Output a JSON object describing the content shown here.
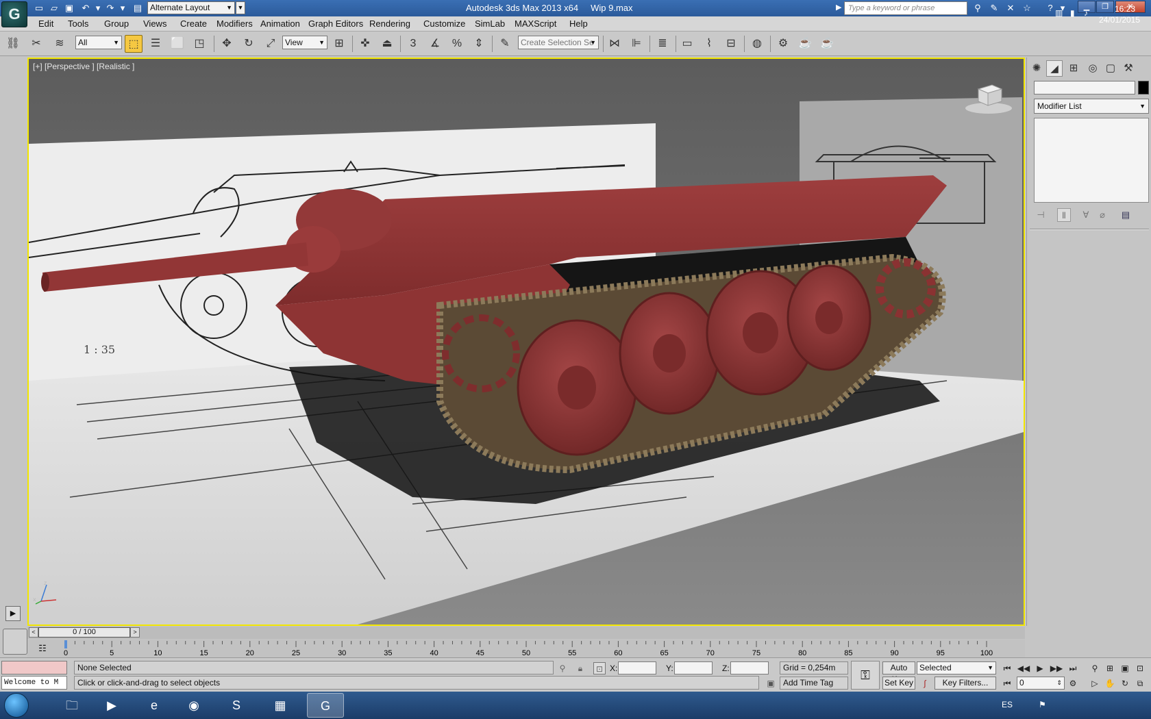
{
  "titlebar": {
    "logo_text": "G",
    "workspace": "Alternate Layout",
    "app_title": "Autodesk 3ds Max  2013 x64",
    "file_name": "Wip 9.max",
    "search_placeholder": "Type a keyword or phrase",
    "icons": [
      "new-icon",
      "open-icon",
      "save-icon",
      "undo-icon",
      "redo-icon",
      "project-folder-icon",
      "infocenter-search-icon",
      "subscription-icon",
      "communication-icon",
      "favorites-icon",
      "help-icon"
    ]
  },
  "menu": {
    "items": [
      "Edit",
      "Tools",
      "Group",
      "Views",
      "Create",
      "Modifiers",
      "Animation",
      "Graph Editors",
      "Rendering",
      "Customize",
      "SimLab",
      "MAXScript",
      "Help"
    ]
  },
  "toolbar": {
    "selection_filter": "All",
    "reference_coord": "View",
    "snap_label": "3",
    "named_selection": "Create Selection Se"
  },
  "viewport": {
    "label": "[+] [Perspective ] [Realistic ]",
    "colors": {
      "hull": "#8e3434",
      "border_active": "#f2e600"
    }
  },
  "command_panel": {
    "modifier_list": "Modifier List"
  },
  "timeline": {
    "frame_display": "0 / 100",
    "ticks": [
      5,
      10,
      15,
      20,
      25,
      30,
      35,
      40,
      45,
      50,
      55,
      60,
      65,
      70,
      75,
      80,
      85,
      90,
      95,
      100
    ],
    "start_tick": "0"
  },
  "status": {
    "maxscript_text": "Welcome to M",
    "selection": "None Selected",
    "prompt": "Click or click-and-drag to select objects",
    "x_label": "X:",
    "y_label": "Y:",
    "z_label": "Z:",
    "grid": "Grid = 0,254m",
    "add_time_tag": "Add Time Tag",
    "auto_key": "Auto Key",
    "key_mode": "Selected",
    "set_key": "Set Key",
    "key_filters": "Key Filters...",
    "current_frame": "0"
  },
  "taskbar": {
    "apps": [
      "file-explorer",
      "media-player",
      "internet-explorer",
      "firefox",
      "skype",
      "photo-viewer",
      "3ds-max"
    ],
    "language": "ES",
    "time": "16:23",
    "date": "24/01/2015"
  }
}
